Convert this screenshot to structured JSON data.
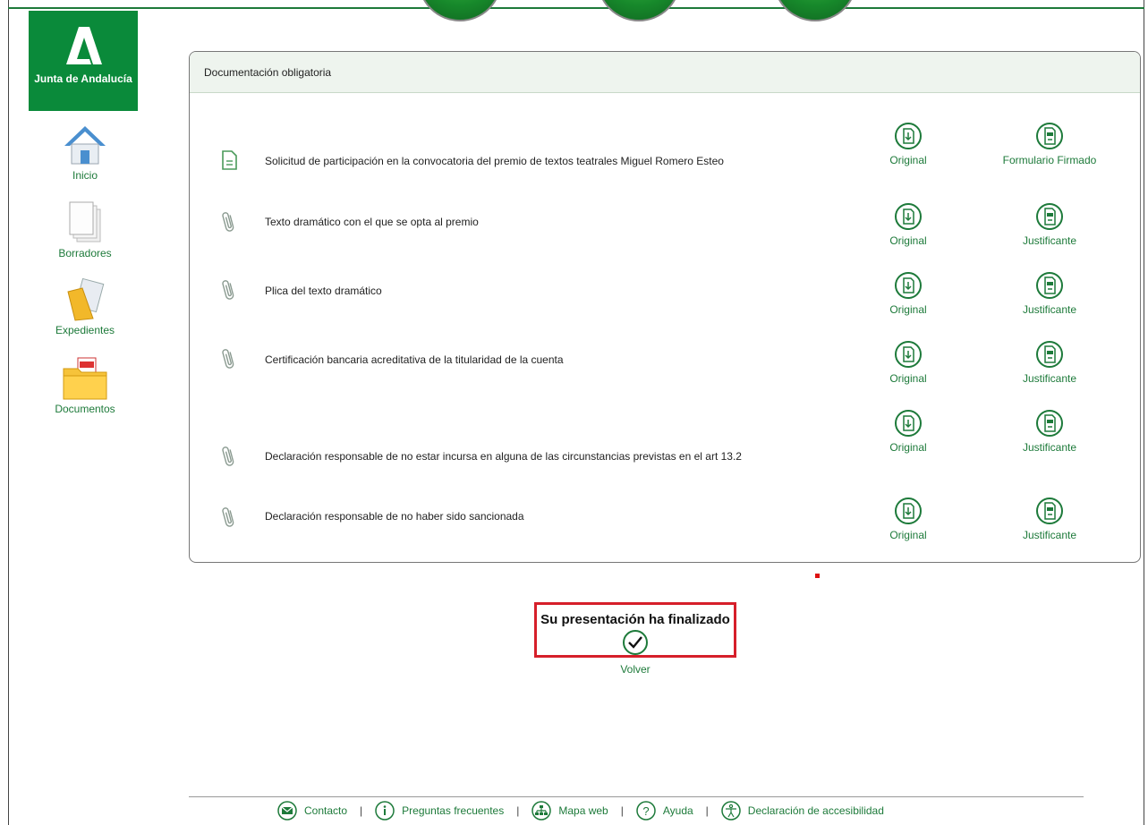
{
  "branding": {
    "logo_text": "Junta de Andalucía"
  },
  "sidebar": {
    "items": [
      {
        "label": "Inicio",
        "icon": "home-icon"
      },
      {
        "label": "Borradores",
        "icon": "drafts-icon"
      },
      {
        "label": "Expedientes",
        "icon": "folder-files-icon"
      },
      {
        "label": "Documentos",
        "icon": "pdf-folder-icon"
      }
    ]
  },
  "panel": {
    "title": "Documentación obligatoria",
    "rows": [
      {
        "name": "Solicitud de participación en la convocatoria del premio de textos teatrales Miguel Romero Esteo",
        "icon": "document-icon",
        "action1": "Original",
        "action2": "Formulario Firmado"
      },
      {
        "name": "Texto dramático con el que se opta al premio",
        "icon": "paperclip-icon",
        "action1": "Original",
        "action2": "Justificante"
      },
      {
        "name": "Plica del texto dramático",
        "icon": "paperclip-icon",
        "action1": "Original",
        "action2": "Justificante"
      },
      {
        "name": "Certificación bancaria acreditativa de la titularidad de la cuenta",
        "icon": "paperclip-icon",
        "action1": "Original",
        "action2": "Justificante"
      },
      {
        "name": "Declaración responsable de no estar incursa en alguna de las circunstancias previstas en el art 13.2",
        "icon": "paperclip-icon",
        "action1": "Original",
        "action2": "Justificante"
      },
      {
        "name": "Declaración responsable de no haber sido sancionada",
        "icon": "paperclip-icon",
        "action1": "Original",
        "action2": "Justificante"
      }
    ]
  },
  "completion": {
    "message": "Su presentación ha finalizado",
    "back_label": "Volver"
  },
  "footer": {
    "links": [
      {
        "label": "Contacto",
        "icon": "mail-icon"
      },
      {
        "label": "Preguntas frecuentes",
        "icon": "info-icon"
      },
      {
        "label": "Mapa web",
        "icon": "sitemap-icon"
      },
      {
        "label": "Ayuda",
        "icon": "help-icon"
      },
      {
        "label": "Declaración de accesibilidad",
        "icon": "accessibility-icon"
      }
    ]
  },
  "colors": {
    "brand_green": "#0a8a3a",
    "link_green": "#1d7a3a",
    "highlight_red": "#d61f2a"
  }
}
